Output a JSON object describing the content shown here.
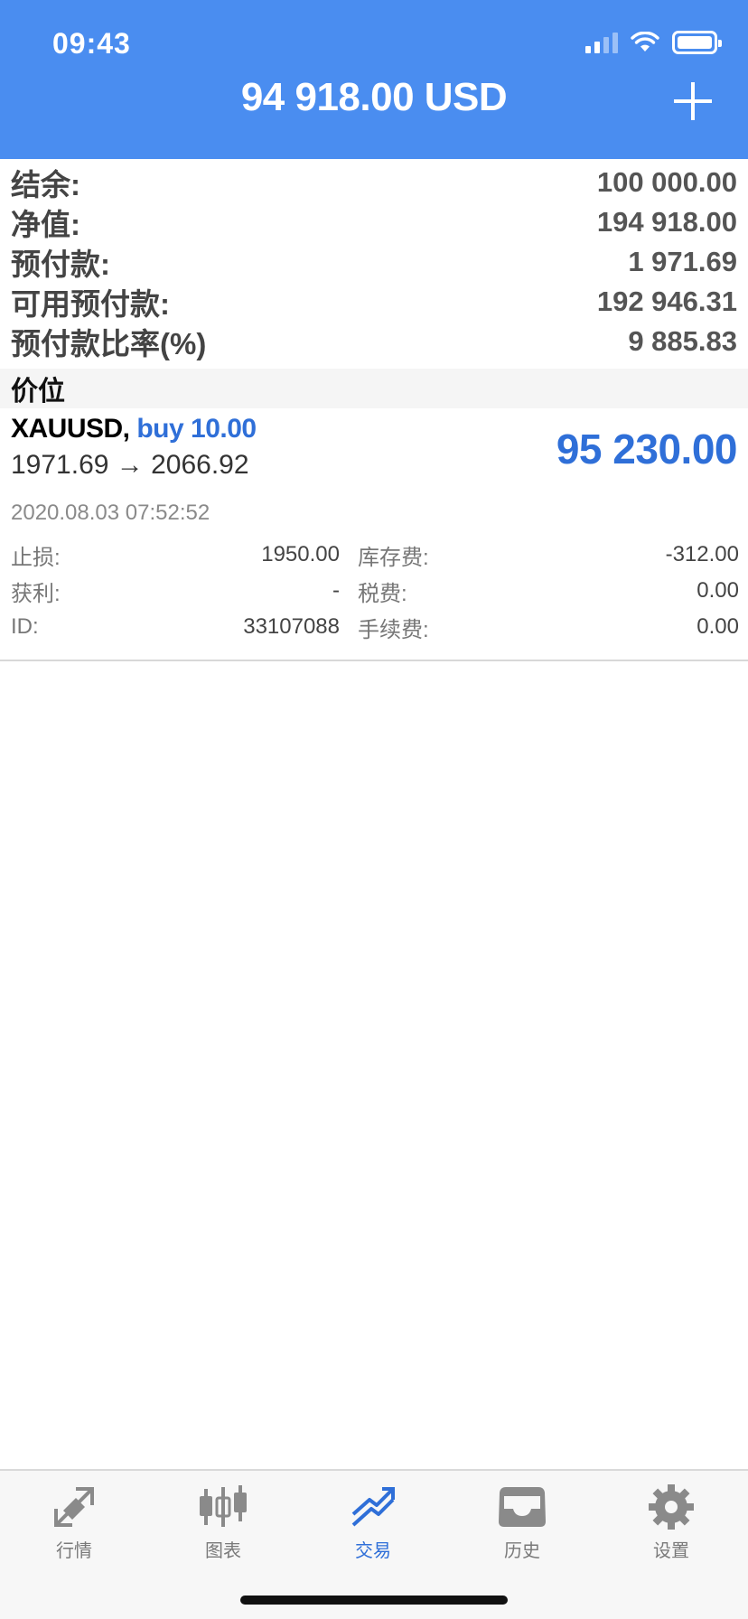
{
  "status_bar": {
    "time": "09:43"
  },
  "header": {
    "title": "94 918.00 USD",
    "add_icon": "plus-icon"
  },
  "summary": [
    {
      "label": "结余:",
      "value": "100 000.00"
    },
    {
      "label": "净值:",
      "value": "194 918.00"
    },
    {
      "label": "预付款:",
      "value": "1 971.69"
    },
    {
      "label": "可用预付款:",
      "value": "192 946.31"
    },
    {
      "label": "预付款比率(%)",
      "value": "9 885.83"
    }
  ],
  "section": {
    "title": "价位"
  },
  "position": {
    "symbol": "XAUUSD,",
    "side": "buy 10.00",
    "prices": "1971.69 → 2066.92",
    "profit": "95 230.00",
    "time": "2020.08.03 07:52:52",
    "details": [
      {
        "label_l": "止损:",
        "value_l": "1950.00",
        "label_r": "库存费:",
        "value_r": "-312.00"
      },
      {
        "label_l": "获利:",
        "value_l": "-",
        "label_r": "税费:",
        "value_r": "0.00"
      },
      {
        "label_l": "ID:",
        "value_l": "33107088",
        "label_r": "手续费:",
        "value_r": "0.00"
      }
    ]
  },
  "tabs": [
    {
      "label": "行情",
      "icon": "quotes-icon"
    },
    {
      "label": "图表",
      "icon": "chart-candles-icon"
    },
    {
      "label": "交易",
      "icon": "trade-icon",
      "active": true
    },
    {
      "label": "历史",
      "icon": "history-inbox-icon"
    },
    {
      "label": "设置",
      "icon": "settings-gear-icon"
    }
  ],
  "colors": {
    "header": "#4a8df0",
    "accent": "#2f6fd8"
  }
}
